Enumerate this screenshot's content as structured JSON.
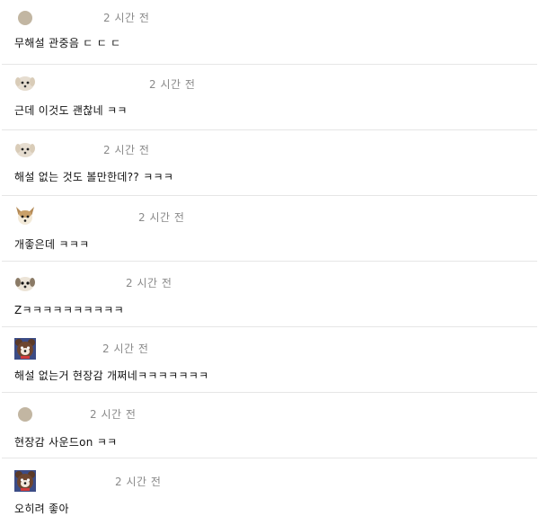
{
  "comments": [
    {
      "avatar": "dot-avatar",
      "time": "2 시간 전",
      "text": "무해설 관중음 ㄷ ㄷ ㄷ"
    },
    {
      "avatar": "puppy-avatar",
      "time": "2 시간 전",
      "text": "근데 이것도 괜찮네 ㅋㅋ"
    },
    {
      "avatar": "puppy-avatar",
      "time": "2 시간 전",
      "text": "해설 없는 것도 볼만한데?? ㅋㅋㅋ"
    },
    {
      "avatar": "chihuahua-avatar",
      "time": "2 시간 전",
      "text": "개좋은데 ㅋㅋㅋ"
    },
    {
      "avatar": "puppy-avatar",
      "time": "2 시간 전",
      "text": "Zㅋㅋㅋㅋㅋㅋㅋㅋㅋㅋ"
    },
    {
      "avatar": "bear-avatar",
      "time": "2 시간 전",
      "text": "해설 없는거 현장감 개쩌네ㅋㅋㅋㅋㅋㅋㅋ"
    },
    {
      "avatar": "dot-avatar",
      "time": "2 시간 전",
      "text": "현장감 사운드on ㅋㅋ"
    },
    {
      "avatar": "bear-avatar",
      "time": "2 시간 전",
      "text": "오히려 좋아"
    }
  ]
}
